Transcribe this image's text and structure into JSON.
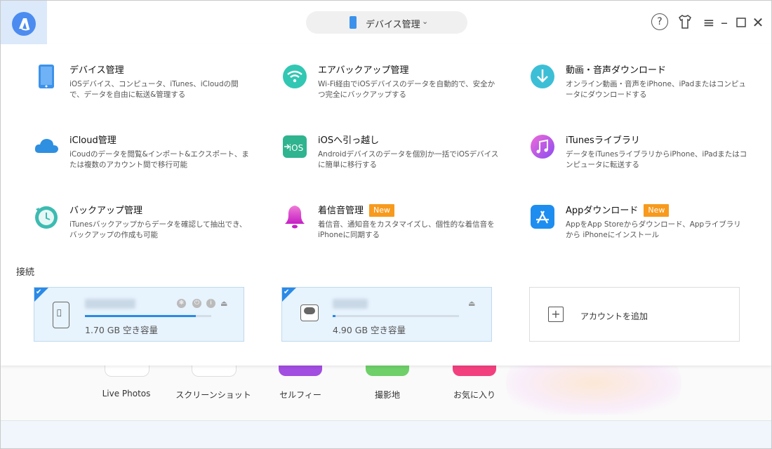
{
  "header": {
    "device_selector_label": "デバイス管理",
    "window_controls": [
      "help-icon",
      "tshirt-icon",
      "menu-icon",
      "minimize-icon",
      "maximize-icon",
      "close-icon"
    ]
  },
  "features": [
    {
      "title": "デバイス管理",
      "badge": "",
      "desc": "iOSデバイス、コンピュータ、iTunes、iCloudの間で、データを自由に転送&管理する",
      "icon": "phone-icon"
    },
    {
      "title": "エアバックアップ管理",
      "badge": "",
      "desc": "Wi-Fi経由でiOSデバイスのデータを自動的で、安全かつ完全にバックアップする",
      "icon": "wifi-backup-icon"
    },
    {
      "title": "動画・音声ダウンロード",
      "badge": "",
      "desc": "オンライン動画・音声をiPhone、iPadまたはコンピュータにダウンロードする",
      "icon": "download-icon"
    },
    {
      "title": "iCloud管理",
      "badge": "",
      "desc": "iCoudのデータを閲覧&インポート&エクスポート、または複数のアカウント間で移行可能",
      "icon": "cloud-icon"
    },
    {
      "title": "iOSへ引っ越し",
      "badge": "",
      "desc": "Androidデバイスのデータを個別か一括でiOSデバイスに簡単に移行する",
      "icon": "ios-move-icon",
      "icon_text": "iOS"
    },
    {
      "title": "iTunesライブラリ",
      "badge": "",
      "desc": "データをiTunesライブラリからiPhone、iPadまたはコンピュータに転送する",
      "icon": "music-icon"
    },
    {
      "title": "バックアップ管理",
      "badge": "",
      "desc": "iTunesバックアップからデータを確認して抽出でき、バックアップの作成も可能",
      "icon": "backup-clock-icon"
    },
    {
      "title": "着信音管理",
      "badge": "New",
      "desc": "着信音、通知音をカスタマイズし、個性的な着信音をiPhoneに同期する",
      "icon": "bell-icon"
    },
    {
      "title": "Appダウンロード",
      "badge": "New",
      "desc": "AppをApp Storeからダウンロード、Appライブラリから iPhoneにインストール",
      "icon": "app-store-icon"
    }
  ],
  "connection": {
    "label": "接続",
    "devices": [
      {
        "name": "",
        "free_space": "1.70 GB 空き容量",
        "usage": 0.88,
        "kind": "iphone",
        "checked": true
      },
      {
        "name": "",
        "free_space": "4.90 GB 空き容量",
        "usage": 0.02,
        "kind": "icloud",
        "checked": true
      }
    ],
    "add_account_label": "アカウントを追加"
  },
  "background_tabs": [
    "Live Photos",
    "スクリーンショット",
    "セルフィー",
    "撮影地",
    "お気に入り"
  ],
  "colors": {
    "accent": "#2a8ae6",
    "badge": "#f79a1d",
    "logo": "#4c8cf0"
  }
}
